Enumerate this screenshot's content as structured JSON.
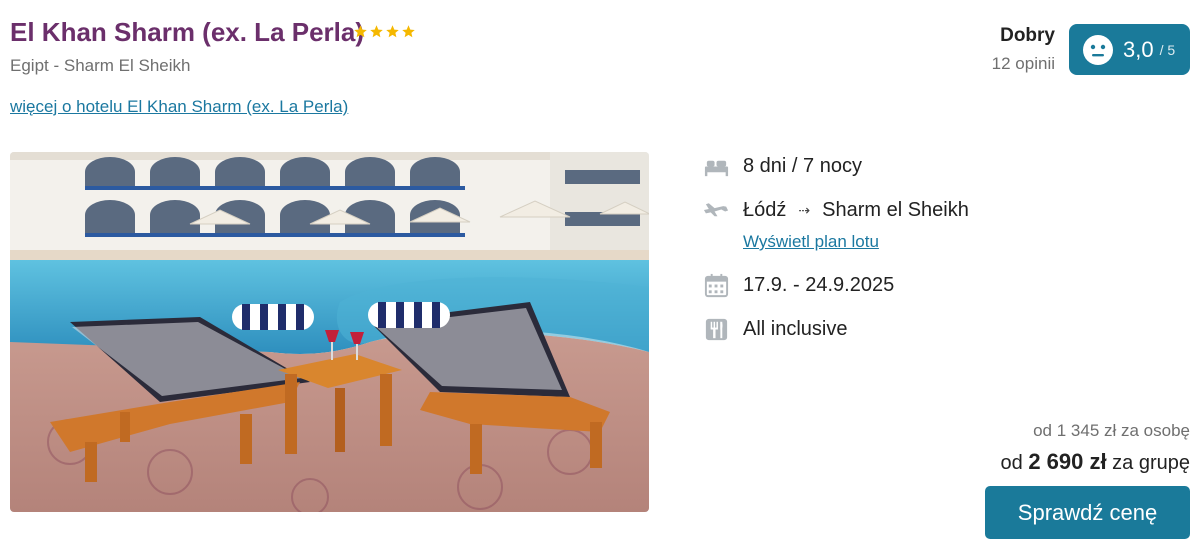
{
  "hotel": {
    "name": "El Khan Sharm (ex. La Perla)",
    "stars": 4,
    "location": "Egipt - Sharm El Sheikh",
    "more_link": "więcej o hotelu El Khan Sharm (ex. La Perla)"
  },
  "rating": {
    "label": "Dobry",
    "count": "12 opinii",
    "value": "3,0",
    "max": "/ 5",
    "icon": "neutral-face-icon"
  },
  "details": {
    "duration": "8 dni / 7 nocy",
    "from": "Łódź",
    "to": "Sharm el Sheikh",
    "flight_plan_link": "Wyświetl plan lotu",
    "dates": "17.9. - 24.9.2025",
    "board": "All inclusive"
  },
  "pricing": {
    "per_person": "od 1 345 zł za osobę",
    "group_prefix": "od ",
    "group_amount": "2 690 zł",
    "group_suffix": " za grupę",
    "button": "Sprawdź cenę"
  },
  "colors": {
    "title": "#6b2f6b",
    "accent": "#1a7a9a",
    "link": "#1b78a0",
    "star": "#f5b800"
  }
}
